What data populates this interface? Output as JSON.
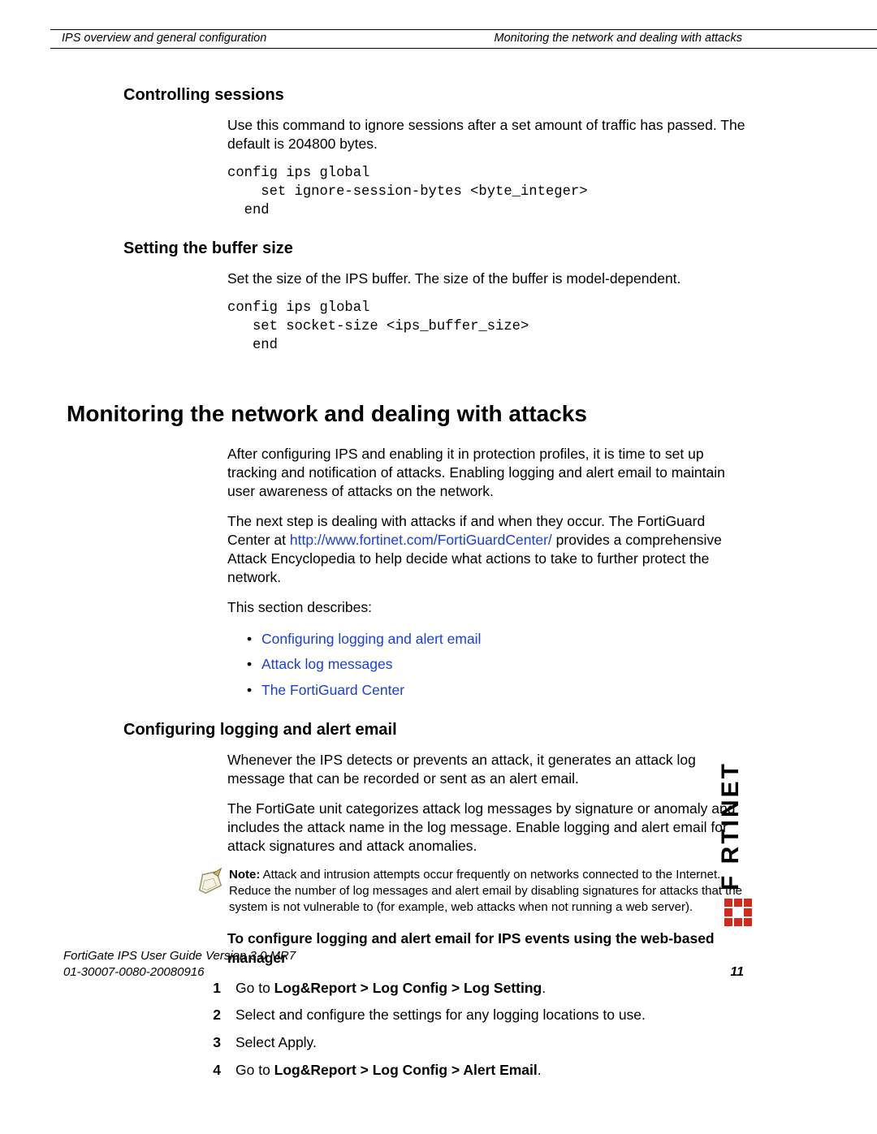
{
  "header": {
    "left": "IPS overview and general configuration",
    "right": "Monitoring the network and dealing with attacks"
  },
  "sections": {
    "controlling_heading": "Controlling sessions",
    "controlling_body": "Use this command to ignore sessions after a set amount of traffic has passed. The default is 204800 bytes.",
    "controlling_code": "config ips global\n    set ignore-session-bytes <byte_integer>\n  end",
    "buffer_heading": "Setting the buffer size",
    "buffer_body": "Set the size of the IPS buffer. The size of the buffer is model-dependent.",
    "buffer_code": "config ips global\n   set socket-size <ips_buffer_size>\n   end",
    "monitor_heading": "Monitoring the network and dealing with attacks",
    "monitor_p1": "After configuring IPS and enabling it in protection profiles, it is time to set up tracking and notification of attacks. Enabling logging and alert email to maintain user awareness of attacks on the network.",
    "monitor_p2a": "The next step is dealing with attacks if and when they occur. The FortiGuard Center at ",
    "monitor_link": "http://www.fortinet.com/FortiGuardCenter/",
    "monitor_p2b": " provides a comprehensive Attack Encyclopedia to help decide what actions to take to further protect the network.",
    "monitor_p3": "This section describes:",
    "bullets": {
      "b1": "Configuring logging and alert email",
      "b2": "Attack log messages",
      "b3": "The FortiGuard Center"
    },
    "conflog_heading": "Configuring logging and alert email",
    "conflog_p1": "Whenever the IPS detects or prevents an attack, it generates an attack log message that can be recorded or sent as an alert email.",
    "conflog_p2": "The FortiGate unit categorizes attack log messages by signature or anomaly and includes the attack name in the log message. Enable logging and alert email for attack signatures and attack anomalies.",
    "note_prefix": "Note:",
    "note_body": " Attack and intrusion attempts occur frequently on networks connected to the Internet. Reduce the number of log messages and alert email by disabling signatures for attacks that the system is not vulnerable to (for example, web attacks when not running a web server).",
    "task_heading": "To configure logging and alert email for IPS events using the web-based manager",
    "steps": {
      "s1a": "Go to ",
      "s1b": "Log&Report > Log Config > Log Setting",
      "s1c": ".",
      "s2": "Select and configure the settings for any logging locations to use.",
      "s3": "Select Apply.",
      "s4a": "Go to ",
      "s4b": "Log&Report > Log Config > Alert Email",
      "s4c": "."
    }
  },
  "footer": {
    "line1": "FortiGate IPS User Guide Version 3.0 MR7",
    "line2": "01-30007-0080-20080916",
    "page": "11"
  },
  "logo_name": "FORTINET"
}
